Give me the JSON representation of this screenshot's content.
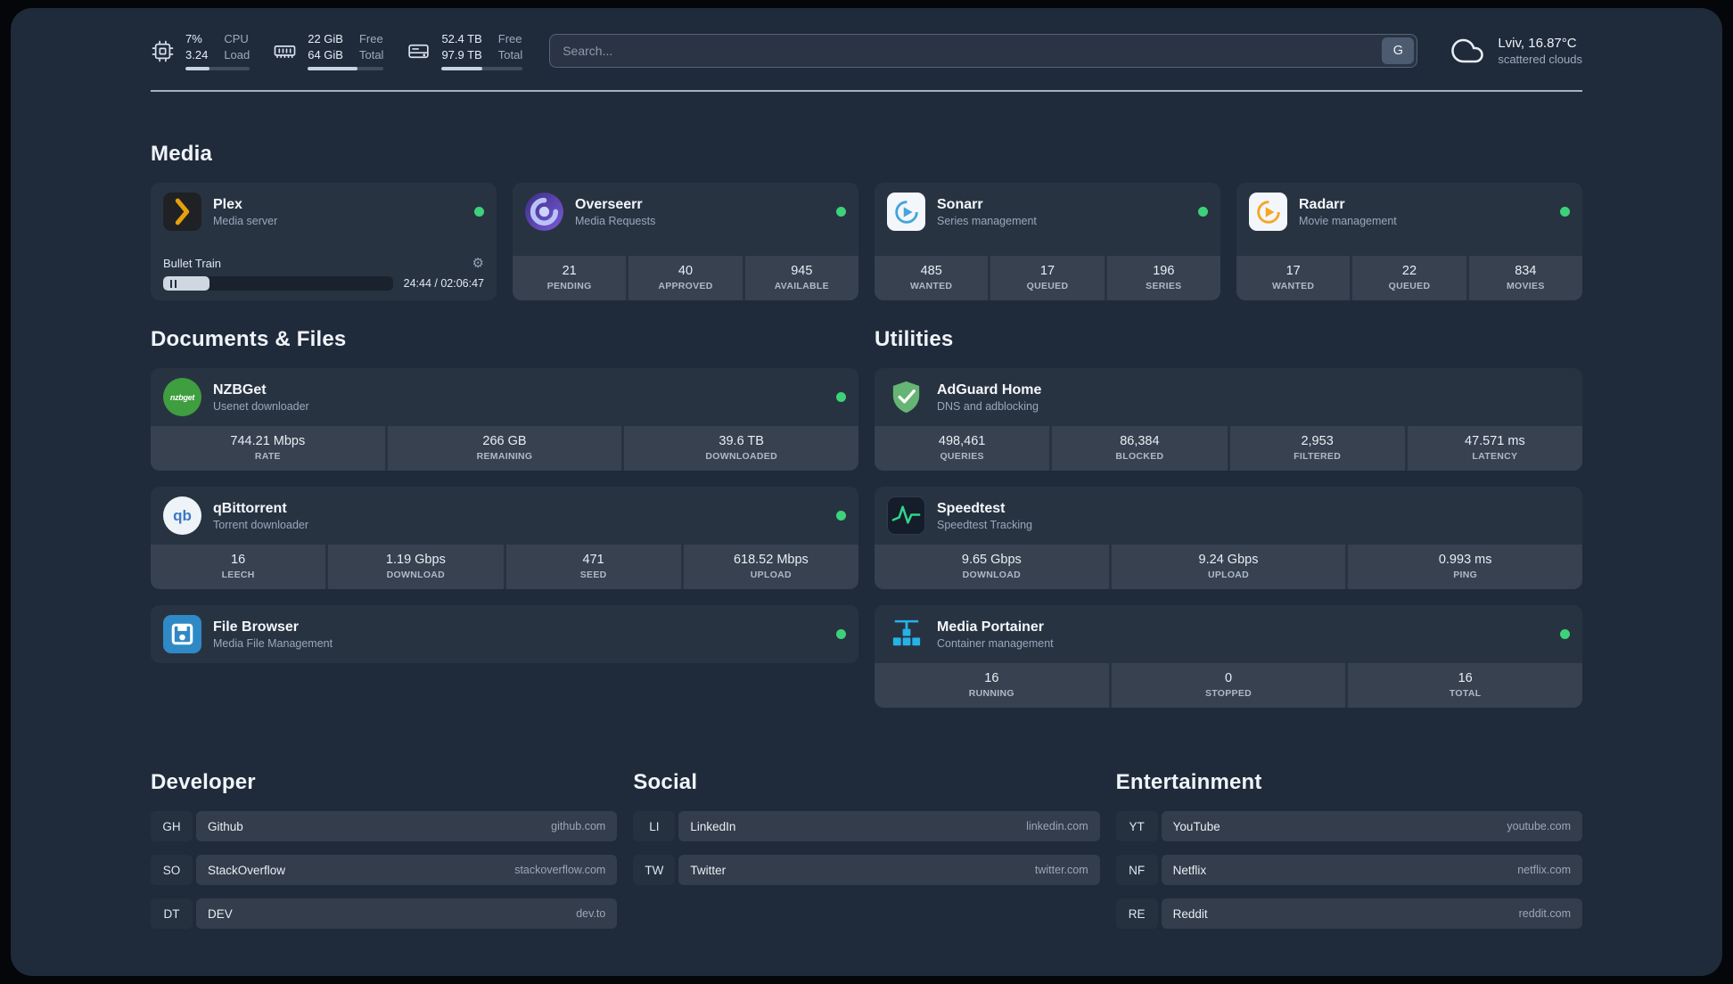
{
  "topbar": {
    "cpu": {
      "icon": "cpu-chip-icon",
      "value_top": "7%",
      "value_bottom": "3.24",
      "label_top": "CPU",
      "label_bottom": "Load",
      "progress": 38
    },
    "memory": {
      "icon": "memory-icon",
      "value_top": "22 GiB",
      "value_bottom": "64 GiB",
      "label_top": "Free",
      "label_bottom": "Total",
      "progress": 66
    },
    "disk": {
      "icon": "hard-disk-icon",
      "value_top": "52.4 TB",
      "value_bottom": "97.9 TB",
      "label_top": "Free",
      "label_bottom": "Total",
      "progress": 50
    },
    "search": {
      "placeholder": "Search...",
      "provider_label": "G"
    },
    "weather": {
      "icon": "cloud-icon",
      "location": "Lviv, 16.87°C",
      "condition": "scattered clouds"
    }
  },
  "sections": {
    "media": {
      "title": "Media",
      "services": [
        {
          "name": "Plex",
          "subtitle": "Media server",
          "icon": "plex-icon",
          "status": "online",
          "player": {
            "title": "Bullet Train",
            "time": "24:44 / 02:06:47",
            "progress": 20
          }
        },
        {
          "name": "Overseerr",
          "subtitle": "Media Requests",
          "icon": "overseerr-icon",
          "status": "online",
          "stats": [
            {
              "value": "21",
              "label": "PENDING"
            },
            {
              "value": "40",
              "label": "APPROVED"
            },
            {
              "value": "945",
              "label": "AVAILABLE"
            }
          ]
        },
        {
          "name": "Sonarr",
          "subtitle": "Series management",
          "icon": "sonarr-icon",
          "status": "online",
          "stats": [
            {
              "value": "485",
              "label": "WANTED"
            },
            {
              "value": "17",
              "label": "QUEUED"
            },
            {
              "value": "196",
              "label": "SERIES"
            }
          ]
        },
        {
          "name": "Radarr",
          "subtitle": "Movie management",
          "icon": "radarr-icon",
          "status": "online",
          "stats": [
            {
              "value": "17",
              "label": "WANTED"
            },
            {
              "value": "22",
              "label": "QUEUED"
            },
            {
              "value": "834",
              "label": "MOVIES"
            }
          ]
        }
      ]
    },
    "documents": {
      "title": "Documents & Files",
      "services": [
        {
          "name": "NZBGet",
          "subtitle": "Usenet downloader",
          "icon": "nzbget-icon",
          "status": "online",
          "stats": [
            {
              "value": "744.21 Mbps",
              "label": "RATE"
            },
            {
              "value": "266 GB",
              "label": "REMAINING"
            },
            {
              "value": "39.6 TB",
              "label": "DOWNLOADED"
            }
          ]
        },
        {
          "name": "qBittorrent",
          "subtitle": "Torrent downloader",
          "icon": "qbittorrent-icon",
          "status": "online",
          "stats": [
            {
              "value": "16",
              "label": "LEECH"
            },
            {
              "value": "1.19 Gbps",
              "label": "DOWNLOAD"
            },
            {
              "value": "471",
              "label": "SEED"
            },
            {
              "value": "618.52 Mbps",
              "label": "UPLOAD"
            }
          ]
        },
        {
          "name": "File Browser",
          "subtitle": "Media File Management",
          "icon": "filebrowser-icon",
          "status": "online"
        }
      ]
    },
    "utilities": {
      "title": "Utilities",
      "services": [
        {
          "name": "AdGuard Home",
          "subtitle": "DNS and adblocking",
          "icon": "adguard-icon",
          "stats": [
            {
              "value": "498,461",
              "label": "QUERIES"
            },
            {
              "value": "86,384",
              "label": "BLOCKED"
            },
            {
              "value": "2,953",
              "label": "FILTERED"
            },
            {
              "value": "47.571 ms",
              "label": "LATENCY"
            }
          ]
        },
        {
          "name": "Speedtest",
          "subtitle": "Speedtest Tracking",
          "icon": "speedtest-icon",
          "stats": [
            {
              "value": "9.65 Gbps",
              "label": "DOWNLOAD"
            },
            {
              "value": "9.24 Gbps",
              "label": "UPLOAD"
            },
            {
              "value": "0.993 ms",
              "label": "PING"
            }
          ]
        },
        {
          "name": "Media Portainer",
          "subtitle": "Container management",
          "icon": "portainer-icon",
          "status": "online",
          "stats": [
            {
              "value": "16",
              "label": "RUNNING"
            },
            {
              "value": "0",
              "label": "STOPPED"
            },
            {
              "value": "16",
              "label": "TOTAL"
            }
          ]
        }
      ]
    }
  },
  "bookmarks": [
    {
      "title": "Developer",
      "items": [
        {
          "abbr": "GH",
          "name": "Github",
          "domain": "github.com"
        },
        {
          "abbr": "SO",
          "name": "StackOverflow",
          "domain": "stackoverflow.com"
        },
        {
          "abbr": "DT",
          "name": "DEV",
          "domain": "dev.to"
        }
      ]
    },
    {
      "title": "Social",
      "items": [
        {
          "abbr": "LI",
          "name": "LinkedIn",
          "domain": "linkedin.com"
        },
        {
          "abbr": "TW",
          "name": "Twitter",
          "domain": "twitter.com"
        }
      ]
    },
    {
      "title": "Entertainment",
      "items": [
        {
          "abbr": "YT",
          "name": "YouTube",
          "domain": "youtube.com"
        },
        {
          "abbr": "NF",
          "name": "Netflix",
          "domain": "netflix.com"
        },
        {
          "abbr": "RE",
          "name": "Reddit",
          "domain": "reddit.com"
        }
      ]
    }
  ],
  "colors": {
    "surface": "#1f2a3a",
    "status_online": "#3dd27a",
    "plex_amber": "#e5a00d",
    "sonarr_blue": "#42a5dc",
    "radarr_orange": "#f5a623",
    "adguard_green": "#66b574",
    "speedtest_green": "#31d48b",
    "portainer_blue": "#27b2e7",
    "filebrowser_blue": "#2f89c6",
    "nzbget_green": "#3f9e3f"
  }
}
